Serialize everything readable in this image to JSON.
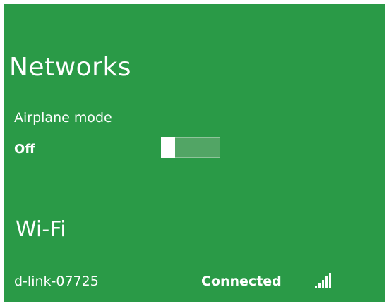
{
  "panel": {
    "title": "Networks",
    "background_color": "#2a9a47"
  },
  "airplane_mode": {
    "label": "Airplane mode",
    "state": "Off",
    "enabled": false
  },
  "wifi": {
    "section_title": "Wi-Fi",
    "networks": [
      {
        "name": "d-link-07725",
        "status": "Connected",
        "signal_icon": "signal-strength-icon",
        "signal_bars": 5
      }
    ]
  }
}
